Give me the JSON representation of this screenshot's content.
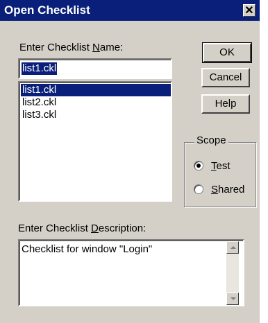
{
  "window": {
    "title": "Open Checklist",
    "close_glyph": "✕"
  },
  "name_field": {
    "label_before": "Enter Checklist ",
    "label_mnemonic": "N",
    "label_after": "ame:",
    "value": "list1.ckl"
  },
  "list": {
    "items": [
      "list1.ckl",
      "list2.ckl",
      "list3.ckl"
    ],
    "selected_index": 0
  },
  "buttons": {
    "ok": "OK",
    "cancel": "Cancel",
    "help": "Help"
  },
  "scope": {
    "label": "Scope",
    "options": [
      {
        "mnemonic": "T",
        "rest": "est",
        "selected": true
      },
      {
        "mnemonic": "S",
        "rest": "hared",
        "selected": false
      }
    ]
  },
  "description": {
    "label_before": "Enter Checklist ",
    "label_mnemonic": "D",
    "label_after": "escription:",
    "value": "Checklist for window \"Login\""
  },
  "colors": {
    "titlebar": "#0a1f7a",
    "dialog_bg": "#d4d0c8",
    "selection": "#0a1f7a"
  }
}
